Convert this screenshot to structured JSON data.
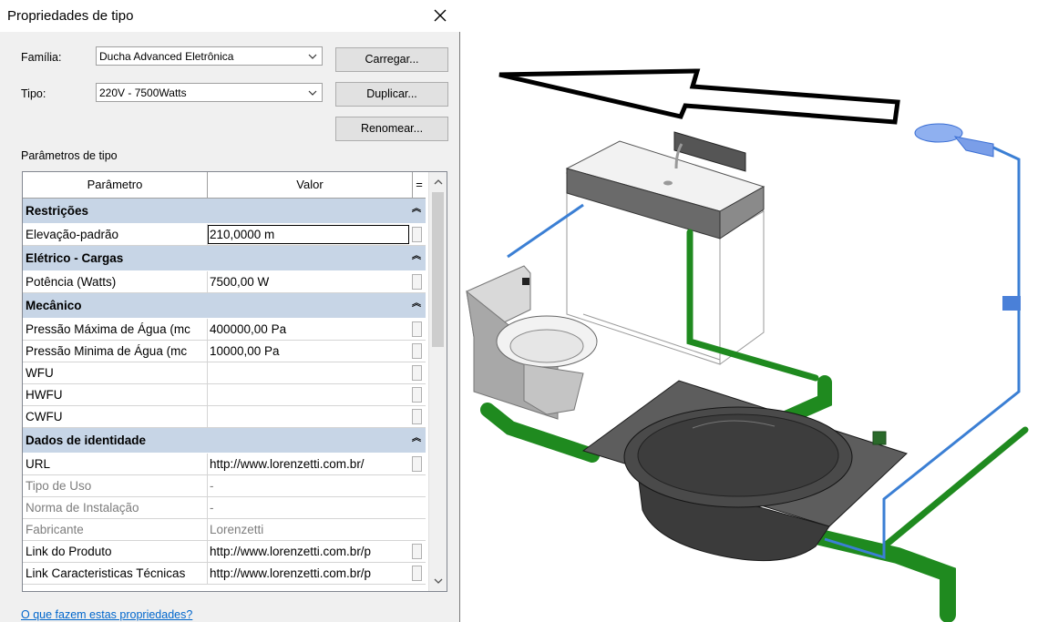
{
  "dialog": {
    "title": "Propriedades de tipo",
    "family_label": "Família:",
    "family_value": "Ducha Advanced Eletrônica",
    "type_label": "Tipo:",
    "type_value": "220V - 7500Watts",
    "load_button": "Carregar...",
    "duplicate_button": "Duplicar...",
    "rename_button": "Renomear...",
    "type_params_label": "Parâmetros de tipo",
    "help_link": "O que fazem estas propriedades?"
  },
  "grid": {
    "col_param": "Parâmetro",
    "col_value": "Valor",
    "col_eq": "=",
    "groups": [
      {
        "title": "Restrições",
        "rows": [
          {
            "name": "Elevação-padrão",
            "value": "210,0000 m"
          }
        ]
      },
      {
        "title": "Elétrico - Cargas",
        "rows": [
          {
            "name": "Potência (Watts)",
            "value": "7500,00 W"
          }
        ]
      },
      {
        "title": "Mecânico",
        "rows": [
          {
            "name": "Pressão Máxima de Água (mc",
            "value": "400000,00 Pa"
          },
          {
            "name": "Pressão Minima de Água (mc",
            "value": "10000,00 Pa"
          },
          {
            "name": "WFU",
            "value": ""
          },
          {
            "name": "HWFU",
            "value": ""
          },
          {
            "name": "CWFU",
            "value": ""
          }
        ]
      },
      {
        "title": "Dados de identidade",
        "rows": [
          {
            "name": "URL",
            "value": "http://www.lorenzetti.com.br/"
          },
          {
            "name": "Tipo de Uso",
            "value": "-"
          },
          {
            "name": "Norma de Instalação",
            "value": "-"
          },
          {
            "name": "Fabricante",
            "value": "Lorenzetti"
          },
          {
            "name": "Link do Produto",
            "value": "http://www.lorenzetti.com.br/p"
          },
          {
            "name": "Link Caracteristicas Técnicas",
            "value": "http://www.lorenzetti.com.br/p"
          }
        ]
      }
    ]
  },
  "colors": {
    "group_bg": "#c7d5e6",
    "pipe_green": "#1f8a1f",
    "pipe_blue": "#3b7fd4",
    "link": "#0066cc"
  },
  "icons": [
    "close-icon",
    "chevron-down-icon",
    "collapse-caret-icon",
    "scroll-up-icon",
    "scroll-down-icon"
  ]
}
